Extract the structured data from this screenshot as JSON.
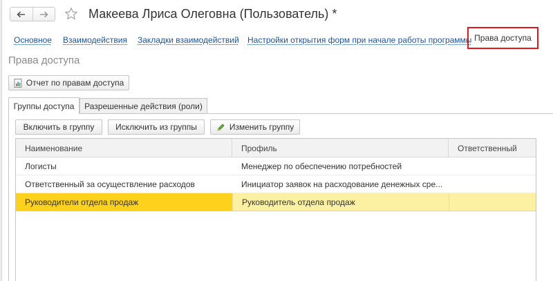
{
  "window": {
    "title": "Макеева Лриса Олеговна (Пользователь) *"
  },
  "nav": {
    "back_icon": "arrow-left-icon",
    "forward_icon": "arrow-right-icon",
    "favorite_icon": "star-outline-icon"
  },
  "links": [
    {
      "label": "Основное"
    },
    {
      "label": "Взаимодействия"
    },
    {
      "label": "Закладки взаимодействий"
    },
    {
      "label": "Настройки открытия форм при начале работы программы"
    }
  ],
  "active_link": {
    "label": "Права доступа",
    "highlight_color": "#e3161b"
  },
  "section_title": "Права доступа",
  "report_button": {
    "label": "Отчет по правам доступа",
    "icon": "report-icon"
  },
  "tabs": [
    {
      "label": "Группы доступа",
      "active": true
    },
    {
      "label": "Разрешенные действия (роли)",
      "active": false
    }
  ],
  "toolbar": {
    "include_label": "Включить в группу",
    "exclude_label": "Исключить из группы",
    "edit_label": "Изменить группу",
    "edit_icon": "pencil-icon"
  },
  "table": {
    "columns": [
      "Наименование",
      "Профиль",
      "Ответственный"
    ],
    "rows": [
      {
        "name": "Логисты",
        "profile": "Менеджер по обеспечению потребностей",
        "responsible": "",
        "selected": false
      },
      {
        "name": "Ответственный за осуществление расходов",
        "profile": "Инициатор заявок на расходование денежных сре...",
        "responsible": "",
        "selected": false
      },
      {
        "name": "Руководители отдела продаж",
        "profile": "Руководитель отдела продаж",
        "responsible": "",
        "selected": true
      }
    ],
    "selection_colors": {
      "name_cell": "#fdd11c",
      "row": "#fcf0a2"
    }
  }
}
